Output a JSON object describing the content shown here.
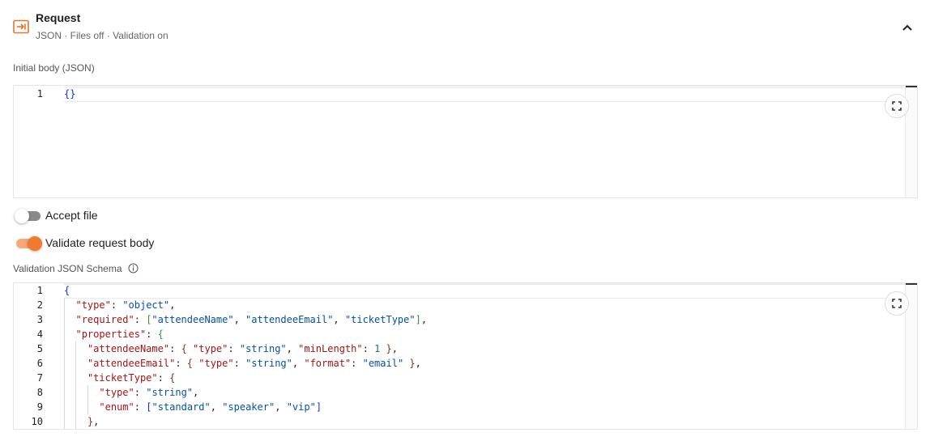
{
  "header": {
    "title": "Request",
    "subtitle": "JSON · Files off · Validation on",
    "accent": "#e8742a"
  },
  "initial_body": {
    "label": "Initial body (JSON)",
    "lines": [
      {
        "num": "1",
        "text": "{}"
      }
    ]
  },
  "toggles": {
    "accept_file": {
      "label": "Accept file",
      "enabled": false
    },
    "validate_body": {
      "label": "Validate request body",
      "enabled": true
    }
  },
  "schema": {
    "label": "Validation JSON Schema",
    "lines": [
      {
        "num": "1",
        "text": "{"
      },
      {
        "num": "2",
        "text": "  \"type\": \"object\","
      },
      {
        "num": "3",
        "text": "  \"required\": [\"attendeeName\", \"attendeeEmail\", \"ticketType\"],"
      },
      {
        "num": "4",
        "text": "  \"properties\": {"
      },
      {
        "num": "5",
        "text": "    \"attendeeName\": { \"type\": \"string\", \"minLength\": 1 },"
      },
      {
        "num": "6",
        "text": "    \"attendeeEmail\": { \"type\": \"string\", \"format\": \"email\" },"
      },
      {
        "num": "7",
        "text": "    \"ticketType\": {"
      },
      {
        "num": "8",
        "text": "      \"type\": \"string\","
      },
      {
        "num": "9",
        "text": "      \"enum\": [\"standard\", \"speaker\", \"vip\"]"
      },
      {
        "num": "10",
        "text": "    },"
      }
    ]
  },
  "colors": {
    "toggle_on": "#f07a2e",
    "toggle_off": "#8a8a8a"
  }
}
